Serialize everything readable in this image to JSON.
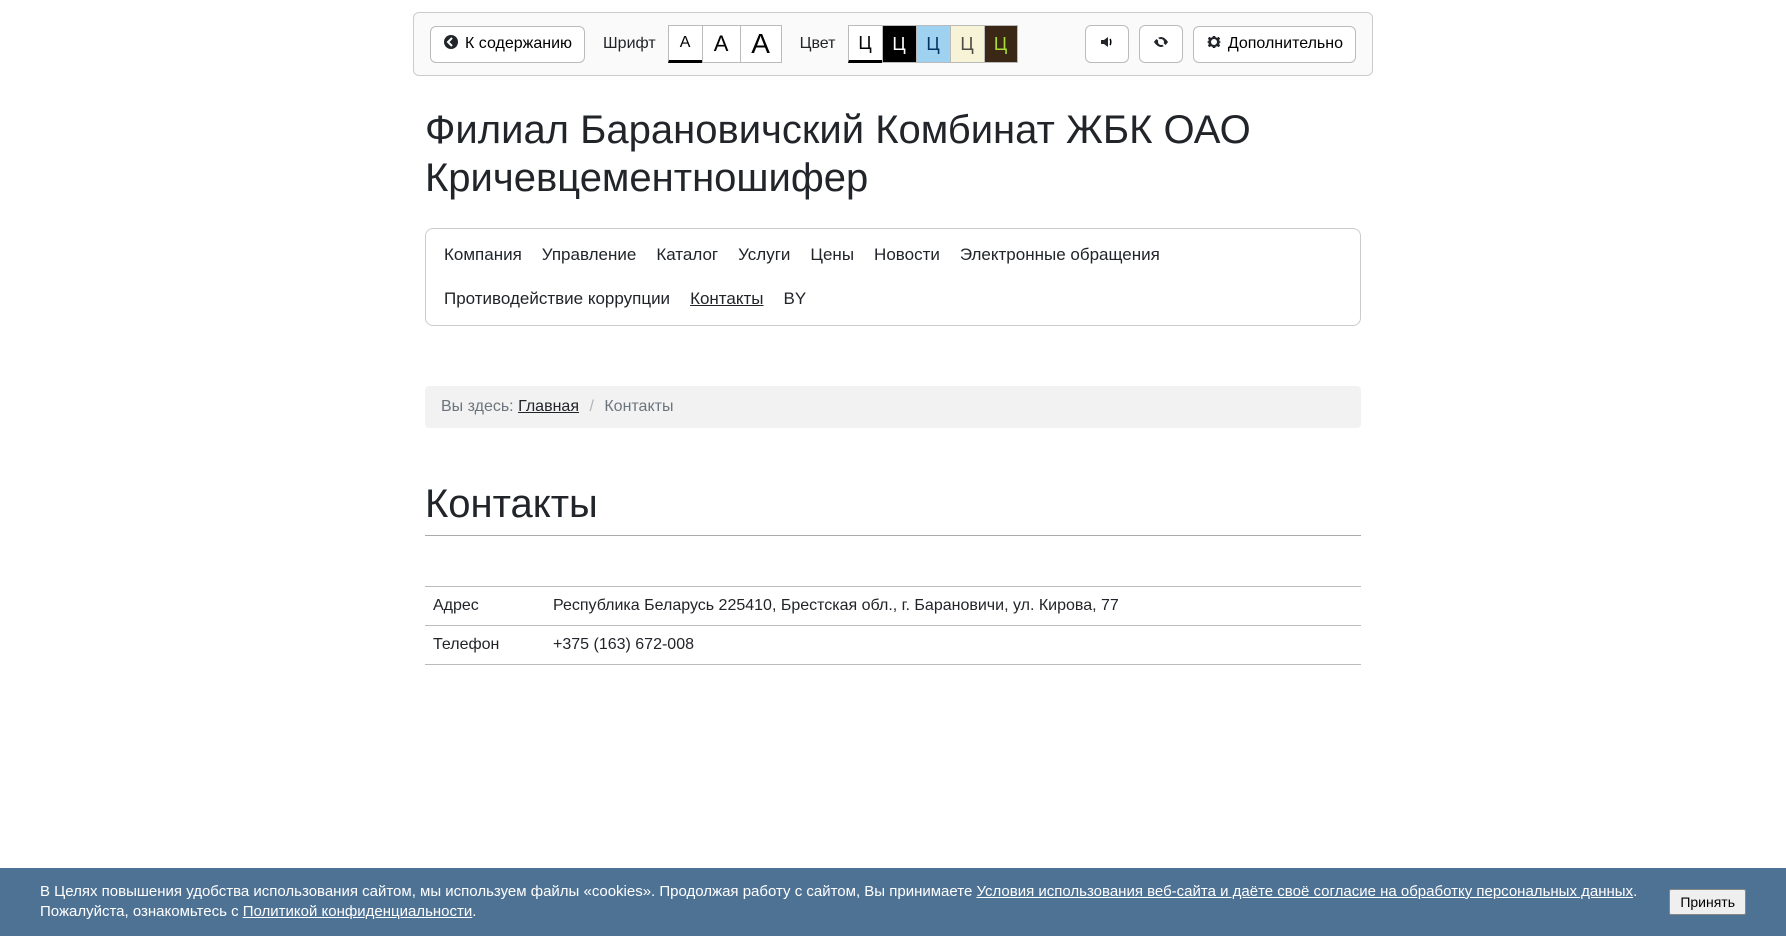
{
  "toolbar": {
    "back_label": "К содержанию",
    "font_label": "Шрифт",
    "font_sizes": [
      "А",
      "А",
      "А"
    ],
    "color_label": "Цвет",
    "color_letters": [
      "Ц",
      "Ц",
      "Ц",
      "Ц",
      "Ц"
    ],
    "more_label": "Дополнительно"
  },
  "site_title": "Филиал Барановичский Комбинат ЖБК ОАО Кричевцементношифер",
  "nav": {
    "items": [
      {
        "label": "Компания",
        "active": false
      },
      {
        "label": "Управление",
        "active": false
      },
      {
        "label": "Каталог",
        "active": false
      },
      {
        "label": "Услуги",
        "active": false
      },
      {
        "label": "Цены",
        "active": false
      },
      {
        "label": "Новости",
        "active": false
      },
      {
        "label": "Электронные обращения",
        "active": false
      },
      {
        "label": "Противодействие коррупции",
        "active": false
      },
      {
        "label": "Контакты",
        "active": true
      },
      {
        "label": "BY",
        "active": false
      }
    ]
  },
  "breadcrumb": {
    "prefix": "Вы здесь:",
    "home": "Главная",
    "current": "Контакты"
  },
  "page_heading": "Контакты",
  "contact_rows": [
    {
      "key": "Адрес",
      "value": "Республика Беларусь 225410, Брестская обл., г. Барановичи, ул. Кирова, 77"
    },
    {
      "key": "Телефон",
      "value": "+375 (163) 672-008"
    }
  ],
  "cookie": {
    "text_prefix": "В Целях повышения удобства использования сайтом, мы используем файлы «cookies». Продолжая работу с сайтом, Вы принимаете ",
    "link1": "Условия использования веб-сайта и даёте своё согласие на обработку персональных данных",
    "text_mid": ". Пожалуйста, ознакомьтесь с ",
    "link2": "Политикой конфиденциальности",
    "text_suffix": ".",
    "accept_label": "Принять"
  }
}
